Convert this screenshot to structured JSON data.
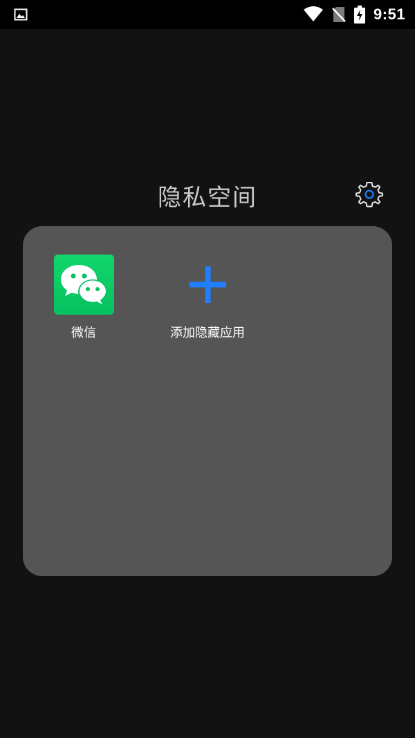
{
  "status_bar": {
    "time": "9:51",
    "icons": [
      "image-icon",
      "wifi-icon",
      "no-sim-icon",
      "battery-charging-icon"
    ]
  },
  "header": {
    "title": "隐私空间",
    "settings_icon": "gear-icon"
  },
  "apps": [
    {
      "label": "微信",
      "icon": "wechat-icon"
    },
    {
      "label": "添加隐藏应用",
      "icon": "plus-icon"
    }
  ],
  "colors": {
    "background": "#121212",
    "card": "#555555",
    "accent": "#1e7fff",
    "wechat_green": "#07c160"
  }
}
